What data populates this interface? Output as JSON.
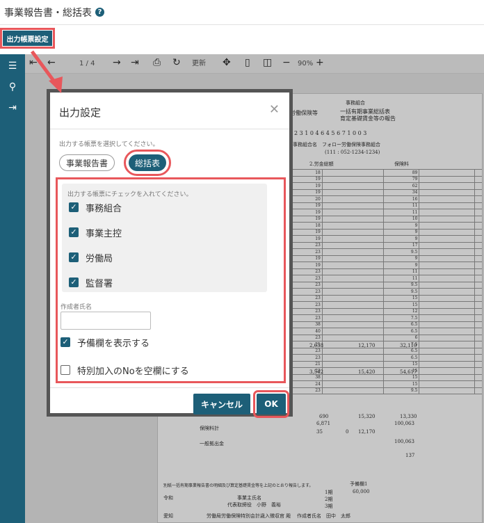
{
  "header": {
    "title": "事業報告書・総括表",
    "help_icon": "?"
  },
  "output_button": {
    "label": "出力帳票設定"
  },
  "sidebar": {
    "items": [
      "menu-icon",
      "search-icon",
      "export-icon"
    ]
  },
  "toolbar": {
    "page": "1 / 4",
    "refresh": "更新",
    "zoom": "90%"
  },
  "dialog": {
    "title": "出力設定",
    "select_hint": "出力する帳票を選択してください。",
    "tabs": [
      {
        "label": "事業報告書"
      },
      {
        "label": "総括表"
      }
    ],
    "check_hint": "出力する帳票にチェックを入れてください。",
    "checks": [
      {
        "label": "事務組合",
        "checked": true
      },
      {
        "label": "事業主控",
        "checked": true
      },
      {
        "label": "労働局",
        "checked": true
      },
      {
        "label": "監督署",
        "checked": true
      }
    ],
    "author_label": "作成者氏名",
    "author_value": "",
    "options": [
      {
        "label": "予備欄を表示する",
        "checked": true
      },
      {
        "label": "特別加入のNoを空欄にする",
        "checked": false
      }
    ],
    "cancel": "キャンセル",
    "ok": "OK"
  },
  "doc": {
    "head1": "労働保険等",
    "head2": "一括有期事業総括表",
    "head3": "育定基礎賃金等の報告",
    "office": "事務組合",
    "digits": "2 3 1 0 4 6 4 5 6 7 1 0 0 3",
    "name": "事務組合名　フォロー労働保険事務組合",
    "phone": "(111 : 052-1234-1234)",
    "col1": "2.労金総額",
    "col2": "保険料",
    "rows": [
      "18",
      "19",
      "19",
      "19",
      "20",
      "19",
      "19",
      "19",
      "18",
      "19",
      "19",
      "23",
      "23",
      "19",
      "19",
      "23",
      "23",
      "23",
      "23",
      "23",
      "23",
      "23",
      "23",
      "38",
      "40",
      "23",
      "21",
      "23",
      "23",
      "21",
      "23",
      "38",
      "24",
      "23"
    ],
    "c3": [
      "89",
      "79",
      "62",
      "34",
      "16",
      "11",
      "11",
      "10",
      "9",
      "9",
      "9",
      "17",
      "9.5",
      "9",
      "9",
      "11",
      "11",
      "9.5",
      "9.5",
      "15",
      "15",
      "12",
      "7.5",
      "6.5",
      "6.5",
      "6",
      "7.5",
      "6.5",
      "6.5",
      "15",
      "15",
      "15",
      "15",
      "9.5"
    ],
    "amounts": {
      "a1": "2,638",
      "a2": "12,170",
      "a3": "32,110",
      "b1": "3,542",
      "b2": "15,420",
      "b3": "54,617",
      "c1": "690",
      "c2": "6,871",
      "c3": "15,320",
      "c4": "13,330",
      "c5": "100,063",
      "d1": "35",
      "d2": "0",
      "d3": "12,170",
      "total": "100,063",
      "sub": "137"
    },
    "labels": {
      "insurance_total": "保険料計",
      "general": "一般拠出金"
    },
    "bottom": {
      "reiwa": "令和",
      "rep": "代表取締役　小野　義裕",
      "rep_label": "事業主氏名",
      "city": "愛知",
      "bureau": "労働局労働保険特別会計歳入徴収官 殿",
      "author": "作成者氏名　田中　太郎",
      "pay_label": "予備欄1",
      "pay_row1": "1期",
      "pay_row1_val": "60,000",
      "pay_row2": "2期",
      "pay_row3": "3期",
      "note": "別紙一括有期事業報告書の明細及び算定基礎賃金等を上記のとおり報告します。"
    }
  }
}
